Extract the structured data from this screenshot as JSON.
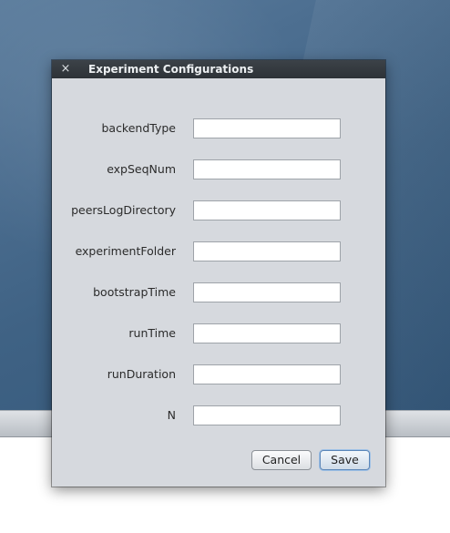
{
  "dialog": {
    "title": "Experiment Configurations",
    "close_symbol": "×",
    "fields": [
      {
        "label": "backendType",
        "value": ""
      },
      {
        "label": "expSeqNum",
        "value": ""
      },
      {
        "label": "peersLogDirectory",
        "value": ""
      },
      {
        "label": "experimentFolder",
        "value": ""
      },
      {
        "label": "bootstrapTime",
        "value": ""
      },
      {
        "label": "runTime",
        "value": ""
      },
      {
        "label": "runDuration",
        "value": ""
      },
      {
        "label": "N",
        "value": ""
      }
    ],
    "buttons": {
      "cancel": "Cancel",
      "save": "Save"
    }
  },
  "colors": {
    "titlebar": "#2d3237",
    "dialog_background": "#d6d9de",
    "desktop_wallpaper": "#3f6284",
    "default_button_focus": "#5b86b8"
  },
  "icons": {
    "close": "close-icon"
  }
}
